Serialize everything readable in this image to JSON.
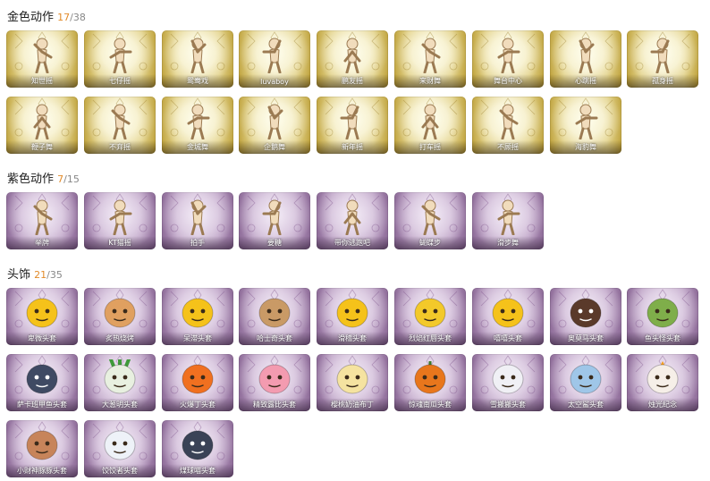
{
  "colors": {
    "owned_count": "#e28b2a",
    "gold_card": "#d8c270",
    "purple_card": "#b497bd"
  },
  "sections": [
    {
      "id": "gold",
      "title": "金色动作",
      "owned": "17",
      "total": "/38",
      "items": [
        "知世摇",
        "七仔摇",
        "鸳鸯戏",
        "luvaboy",
        "鹏友摇",
        "来财舞",
        "舞台中心",
        "心跳摇",
        "孤身摇",
        "鞭子舞",
        "不弃摇",
        "金城舞",
        "企鹅舞",
        "新年摇",
        "打车摇",
        "不顾摇",
        "海豹舞"
      ]
    },
    {
      "id": "purple",
      "title": "紫色动作",
      "owned": "7",
      "total": "/15",
      "items": [
        "举牌",
        "KT猫摇",
        "拍手",
        "要糖",
        "带你逃跑吧",
        "蝴蝶步",
        "滑步舞"
      ]
    },
    {
      "id": "head",
      "title": "头饰",
      "owned": "21",
      "total": "/35",
      "items": [
        "卑微头套",
        "炙热烧烤",
        "呆滞头套",
        "哈士奇头套",
        "滑稽头套",
        "烈焰红唇头套",
        "嘻嘻头套",
        "奥莫马头套",
        "鱼头怪头套",
        "萨卡班甲鱼头套",
        "大葱明头套",
        "火爆丁头套",
        "精致露比头套",
        "樱桃奶油布丁",
        "惊魂南瓜头套",
        "雪搬搬头套",
        "太空鲨头套",
        "烛光纪念",
        "小财神豚豚头套",
        "饺饺者头套",
        "煤球喵头套"
      ],
      "icons": [
        "worried-emoji-icon",
        "grilled-meat-icon",
        "dazed-emoji-icon",
        "husky-sunglasses-icon",
        "silly-emoji-icon",
        "pikachu-sunglasses-icon",
        "grin-emoji-icon",
        "horse-mask-icon",
        "fish-monster-icon",
        "fish-head-icon",
        "scallion-icon",
        "fire-sprite-icon",
        "pink-pig-icon",
        "pudding-icon",
        "pumpkin-icon",
        "snowman-reindeer-icon",
        "space-shark-icon",
        "candle-icon",
        "fortune-pig-icon",
        "dumpling-icon",
        "black-cat-icon"
      ]
    }
  ]
}
